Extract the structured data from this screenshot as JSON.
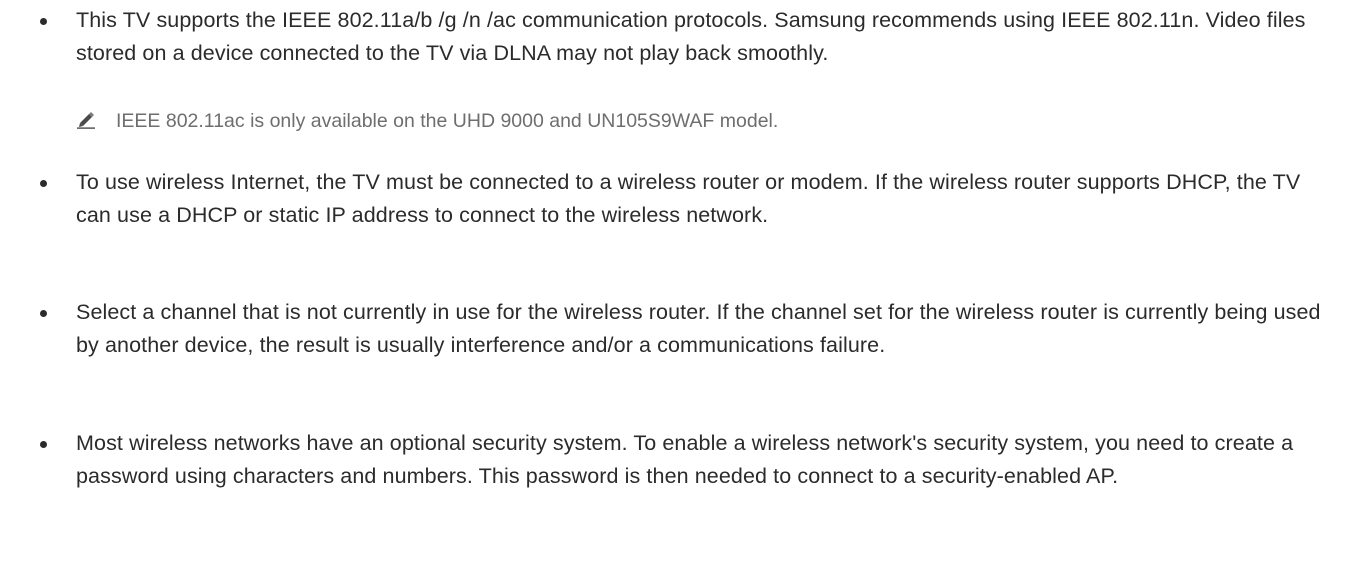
{
  "bullets": [
    {
      "text": "This TV supports the IEEE 802.11a/b /g /n /ac communication protocols. Samsung recommends using IEEE 802.11n. Video files stored on a device connected to the TV via DLNA may not play back smoothly."
    },
    {
      "text": "To use wireless Internet, the TV must be connected to a wireless router or modem. If the wireless router supports DHCP, the TV can use a DHCP or static IP address to connect to the wireless network."
    },
    {
      "text": "Select a channel that is not currently in use for the wireless router. If the channel set for the wireless router is currently being used by another device, the result is usually interference and/or a communications failure."
    },
    {
      "text": "Most wireless networks have an optional security system. To enable a wireless network's security system, you need to create a password using characters and numbers. This password is then needed to connect to a security-enabled AP."
    }
  ],
  "note": {
    "icon": "pencil-icon",
    "text": "IEEE 802.11ac is only available on the UHD 9000 and UN105S9WAF model."
  },
  "colors": {
    "body_text": "#2b2b2b",
    "note_text": "#6e6e6e",
    "background": "#ffffff"
  }
}
